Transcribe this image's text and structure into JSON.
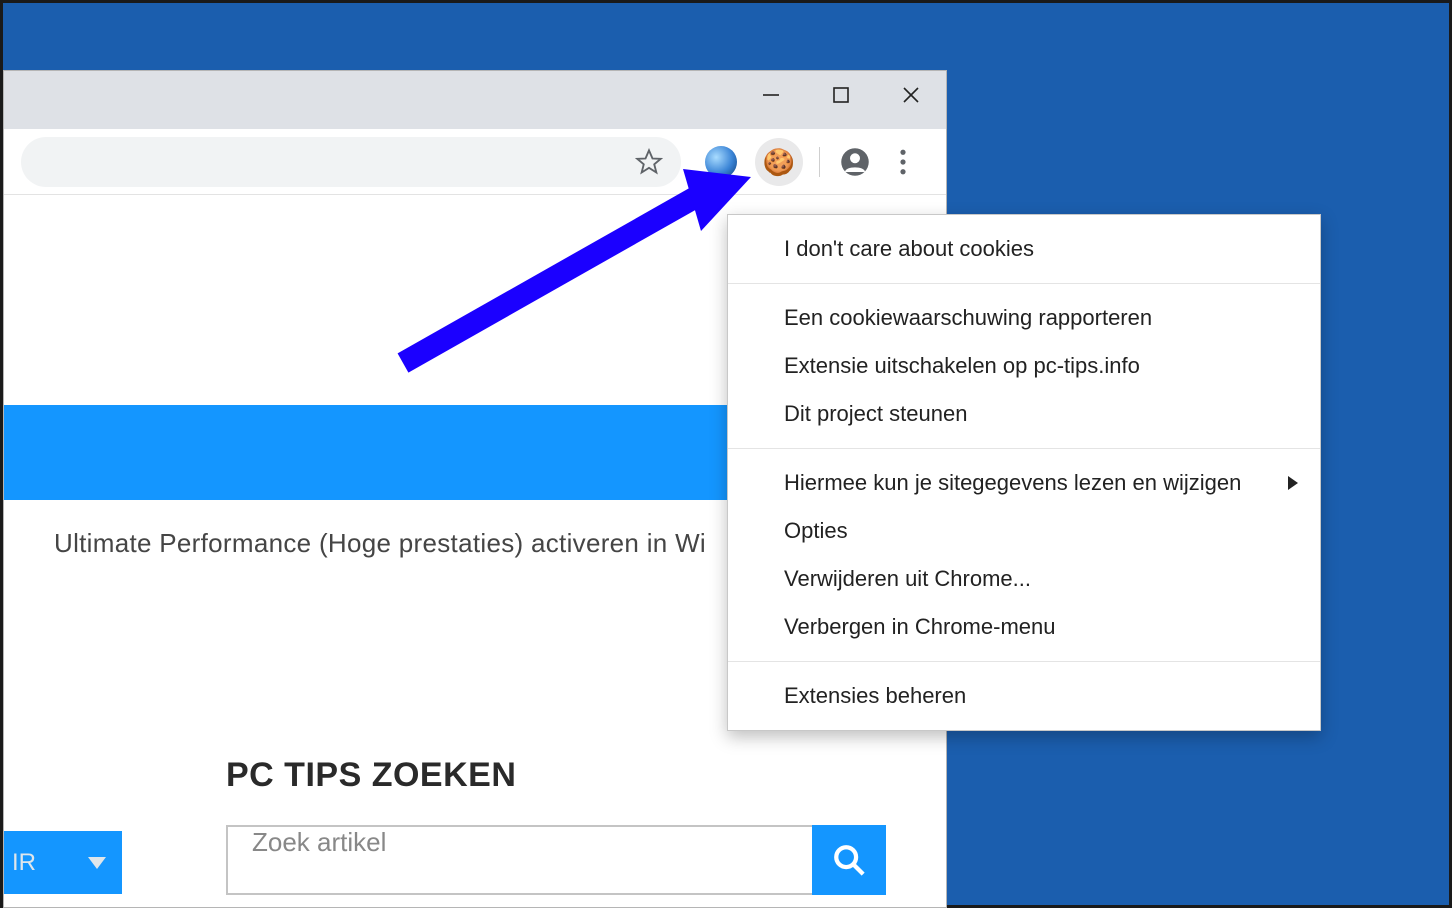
{
  "window": {
    "controls": {
      "minimize": "—",
      "maximize": "▢",
      "close": "✕"
    }
  },
  "addressbar": {
    "star": "☆"
  },
  "extension_icons": {
    "globe": "globe-icon",
    "cookie": "🍪"
  },
  "context_menu": {
    "title": "I don't care about cookies",
    "items_group1": [
      "Een cookiewaarschuwing rapporteren",
      "Extensie uitschakelen op pc-tips.info",
      "Dit project steunen"
    ],
    "items_group2": [
      {
        "label": "Hiermee kun je sitegegevens lezen en wijzigen",
        "submenu": true
      },
      {
        "label": "Opties",
        "submenu": false
      },
      {
        "label": "Verwijderen uit Chrome...",
        "submenu": false
      },
      {
        "label": "Verbergen in Chrome-menu",
        "submenu": false
      }
    ],
    "items_group3": [
      "Extensies beheren"
    ]
  },
  "page": {
    "headline": "Ultimate Performance (Hoge prestaties) activeren in Wi",
    "dropdown_label": "IR",
    "search_title": "PC TIPS ZOEKEN",
    "search_placeholder": "Zoek artikel"
  }
}
